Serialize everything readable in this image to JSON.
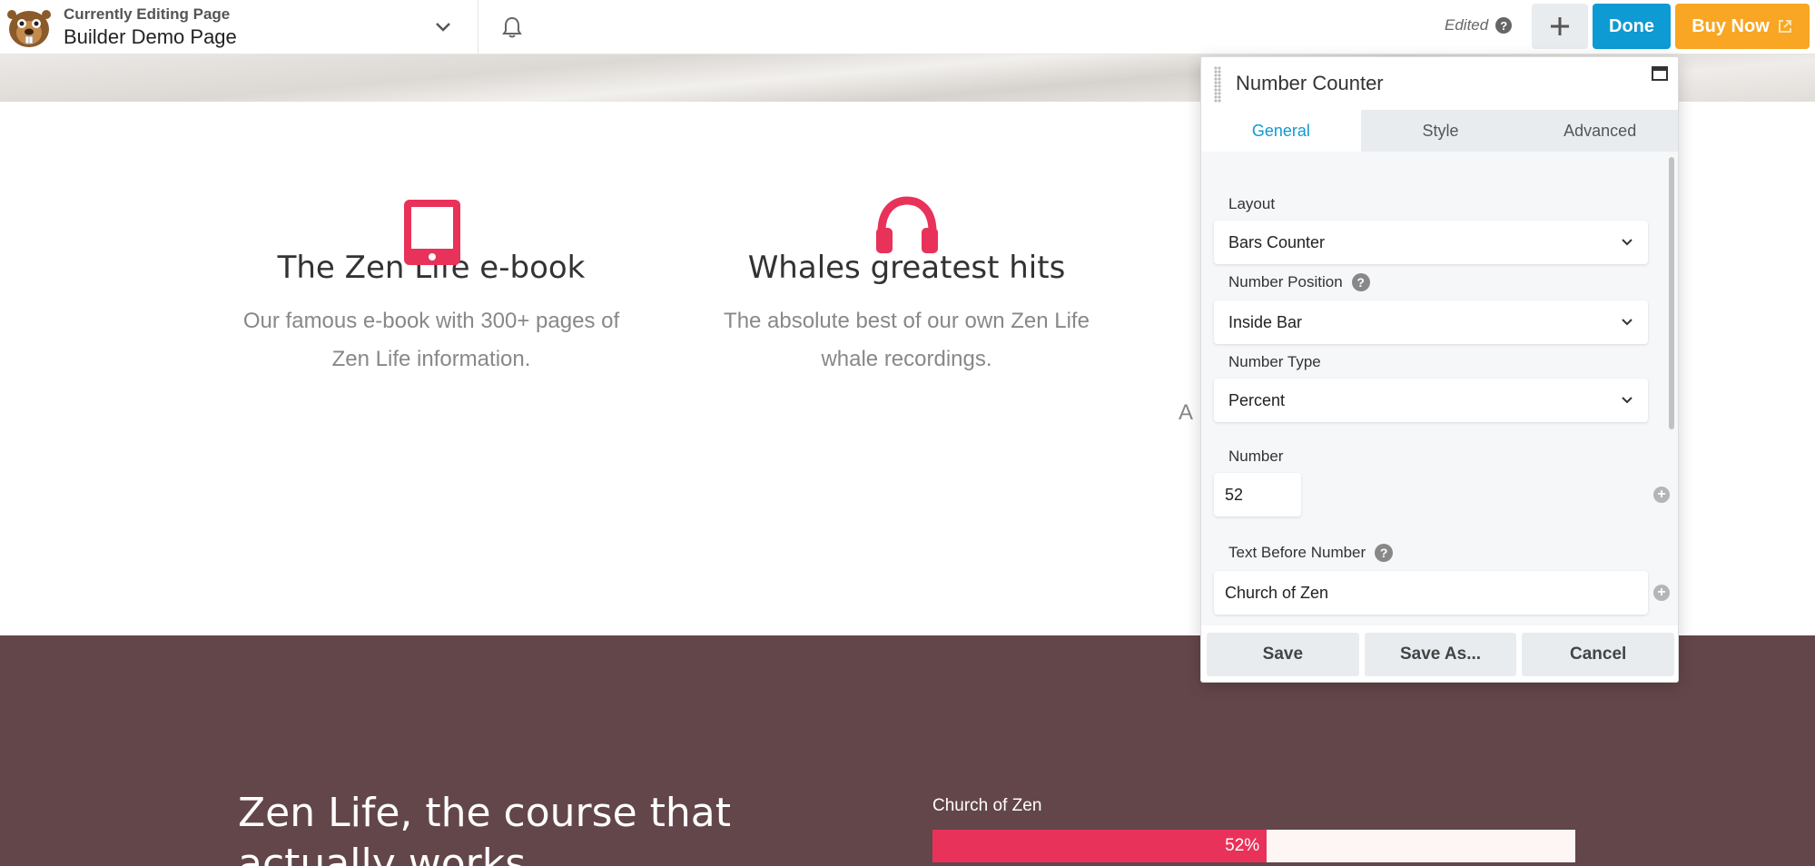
{
  "topbar": {
    "currently_editing": "Currently Editing Page",
    "page_name": "Builder Demo Page",
    "edited_label": "Edited",
    "edited_help": "?",
    "done_label": "Done",
    "buy_label": "Buy Now"
  },
  "features": [
    {
      "title": "The Zen Life e-book",
      "description": "Our famous e-book with 300+ pages of Zen Life information.",
      "icon": "tablet-icon"
    },
    {
      "title": "Whales greatest hits",
      "description": "The absolute best of our own Zen Life whale recordings.",
      "icon": "headphones-icon"
    },
    {
      "partial_text": "A"
    }
  ],
  "colors": {
    "accent_pink": "#e8325a",
    "primary_blue": "#0e9ad3",
    "buy_orange": "#f8a623",
    "dark_section": "#634649"
  },
  "course": {
    "title": "Zen Life, the course that actually works"
  },
  "bar_counter": {
    "label": "Church of Zen",
    "percent": 52,
    "percent_text": "52%"
  },
  "panel": {
    "title": "Number Counter",
    "tabs": [
      {
        "label": "General",
        "active": true
      },
      {
        "label": "Style",
        "active": false
      },
      {
        "label": "Advanced",
        "active": false
      }
    ],
    "fields": {
      "layout_label": "Layout",
      "layout_value": "Bars Counter",
      "number_position_label": "Number Position",
      "number_position_value": "Inside Bar",
      "number_type_label": "Number Type",
      "number_type_value": "Percent",
      "number_label": "Number",
      "number_value": "52",
      "text_before_label": "Text Before Number",
      "text_before_value": "Church of Zen"
    },
    "help": "?",
    "footer": {
      "save": "Save",
      "save_as": "Save As...",
      "cancel": "Cancel"
    }
  }
}
